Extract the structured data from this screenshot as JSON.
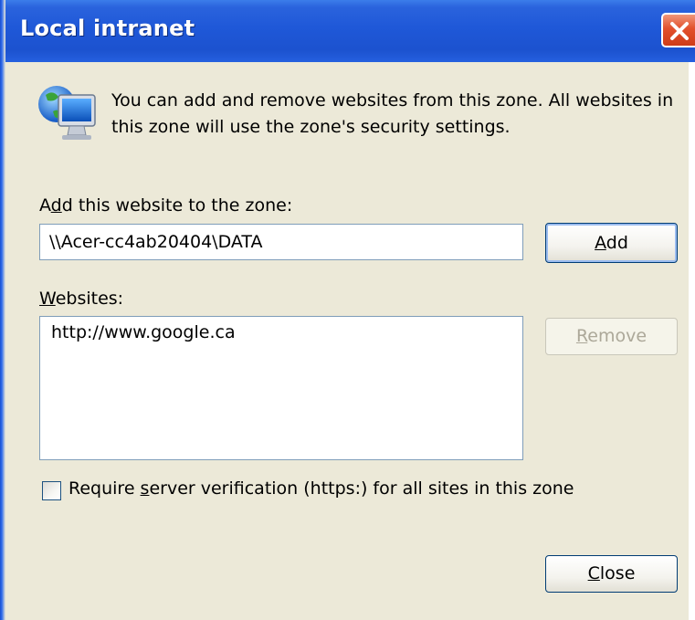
{
  "window": {
    "title": "Local intranet"
  },
  "info": {
    "text": "You can add and remove websites from this zone. All websites in this zone will use the zone's security settings."
  },
  "add_section": {
    "label_pre": "A",
    "label_mnemonic": "d",
    "label_post": "d this website to the zone:",
    "input_value": "\\\\Acer-cc4ab20404\\DATA",
    "add_button_mnemonic": "A",
    "add_button_rest": "dd"
  },
  "websites_section": {
    "label_mnemonic": "W",
    "label_rest": "ebsites:",
    "items": [
      "http://www.google.ca"
    ],
    "remove_button_mnemonic": "R",
    "remove_button_rest": "emove"
  },
  "verification": {
    "label_pre": "Require ",
    "label_mnemonic": "s",
    "label_post": "erver verification (https:) for all sites in this zone",
    "checked": false
  },
  "footer": {
    "close_button_mnemonic": "C",
    "close_button_rest": "lose"
  },
  "icons": {
    "title_close": "close-icon",
    "zone": "globe-monitor-icon"
  }
}
